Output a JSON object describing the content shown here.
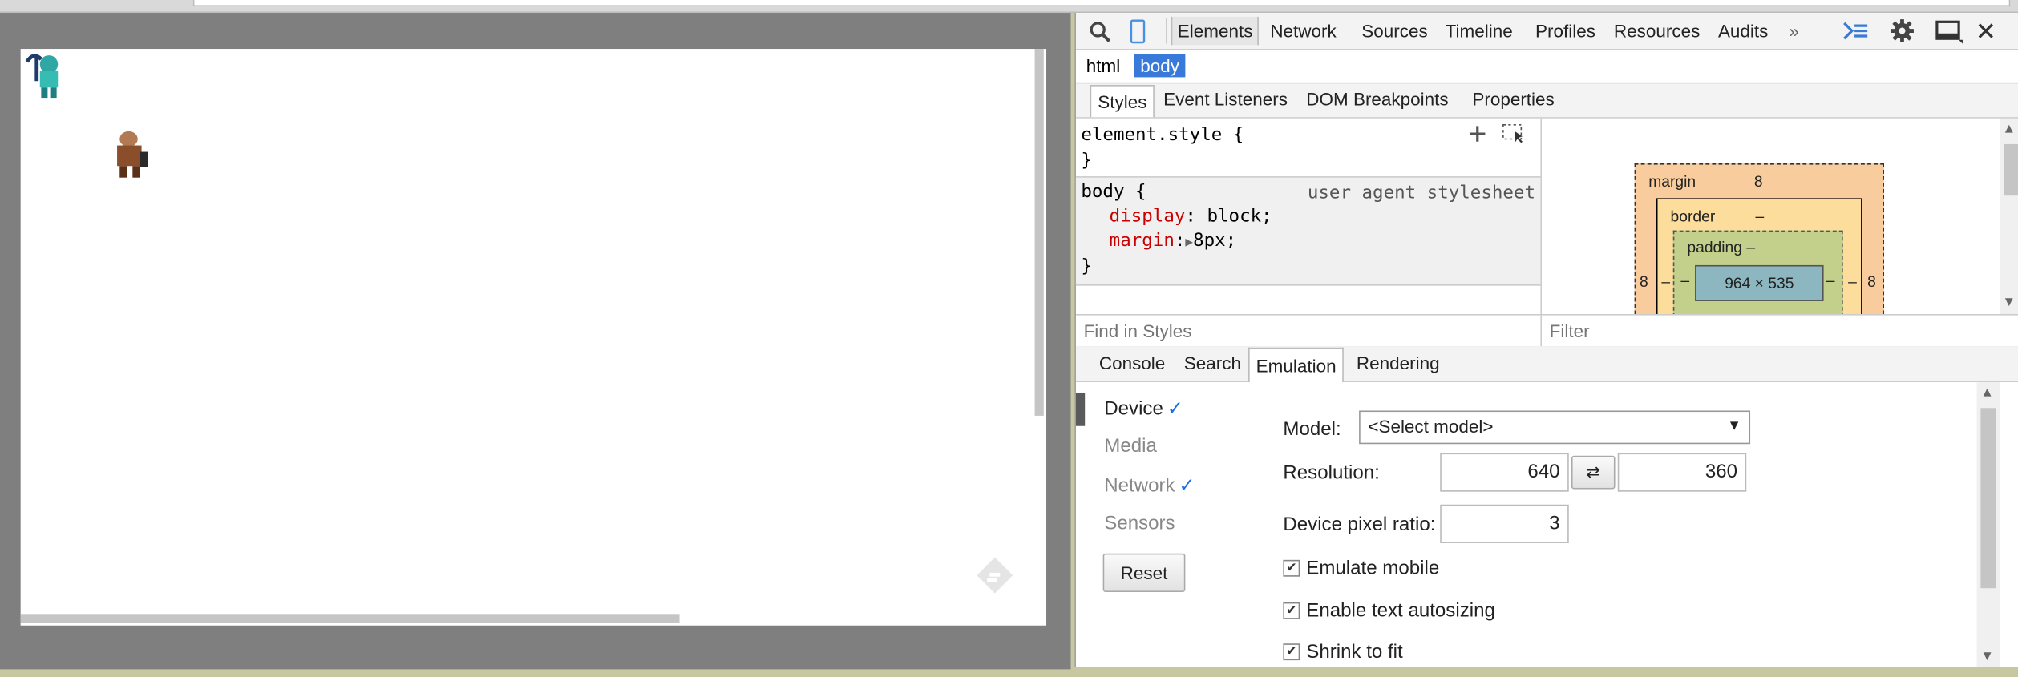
{
  "devtools": {
    "main_tabs": [
      "Elements",
      "Network",
      "Sources",
      "Timeline",
      "Profiles",
      "Resources",
      "Audits"
    ],
    "more_tabs": "»",
    "breadcrumbs": [
      "html",
      "body"
    ],
    "sub_tabs": [
      "Styles",
      "Event Listeners",
      "DOM Breakpoints",
      "Properties"
    ],
    "styles": {
      "element_style": "element.style {",
      "close_brace": "}",
      "body_selector": "body {",
      "ua_label": "user agent stylesheet",
      "prop1_name": "display",
      "prop1_value": "block;",
      "prop2_name": "margin",
      "prop2_value": "8px;"
    },
    "box_model": {
      "margin_label": "margin",
      "margin_top": "8",
      "border_label": "border",
      "border_val": "–",
      "padding_label": "padding –",
      "content": "964 × 535",
      "left": "8",
      "right": "8",
      "dash": "–"
    },
    "find_in_styles_placeholder": "Find in Styles",
    "filter_placeholder": "Filter",
    "drawer_tabs": [
      "Console",
      "Search",
      "Emulation",
      "Rendering"
    ],
    "emulation": {
      "side": [
        "Device",
        "Media",
        "Network",
        "Sensors"
      ],
      "check": "✓",
      "reset": "Reset",
      "model_label": "Model:",
      "model_value": "<Select model>",
      "resolution_label": "Resolution:",
      "res_width": "640",
      "res_height": "360",
      "swap": "⇄",
      "dpr_label": "Device pixel ratio:",
      "dpr_value": "3",
      "emulate_mobile": "Emulate mobile",
      "text_autosizing": "Enable text autosizing",
      "shrink_to_fit": "Shrink to fit"
    }
  },
  "colors": {
    "accent": "#3879d9",
    "css_prop": "#c80000",
    "check_blue": "#1a6ee8"
  },
  "icons": [
    "search-icon",
    "device-mode-icon",
    "console-drawer-icon",
    "gear-icon",
    "dock-icon",
    "close-icon",
    "feedly-icon"
  ]
}
